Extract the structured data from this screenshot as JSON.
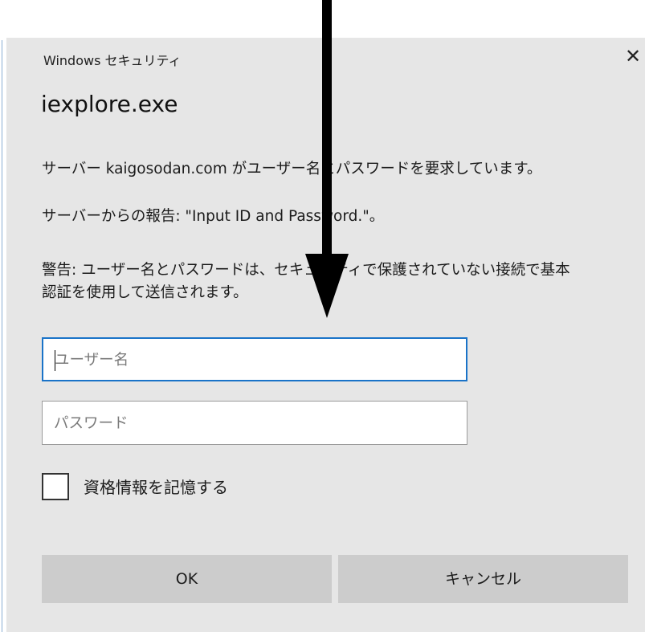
{
  "dialog": {
    "title": "Windows セキュリティ",
    "close_glyph": "✕",
    "app_name": "iexplore.exe",
    "message_server": "サーバー kaigosodan.com がユーザー名とパスワードを要求しています。",
    "message_report": "サーバーからの報告: \"Input ID and Password.\"。",
    "warning_line1": "警告: ユーザー名とパスワードは、セキュリティで保護されていない接続で基本",
    "warning_line2": "認証を使用して送信されます。"
  },
  "form": {
    "username_placeholder": "ユーザー名",
    "password_placeholder": "パスワード",
    "remember_label": "資格情報を記憶する",
    "remember_checked": false
  },
  "buttons": {
    "ok": "OK",
    "cancel": "キャンセル"
  },
  "annotation": {
    "arrow_icon": "down-arrow-icon",
    "color": "#000000"
  }
}
